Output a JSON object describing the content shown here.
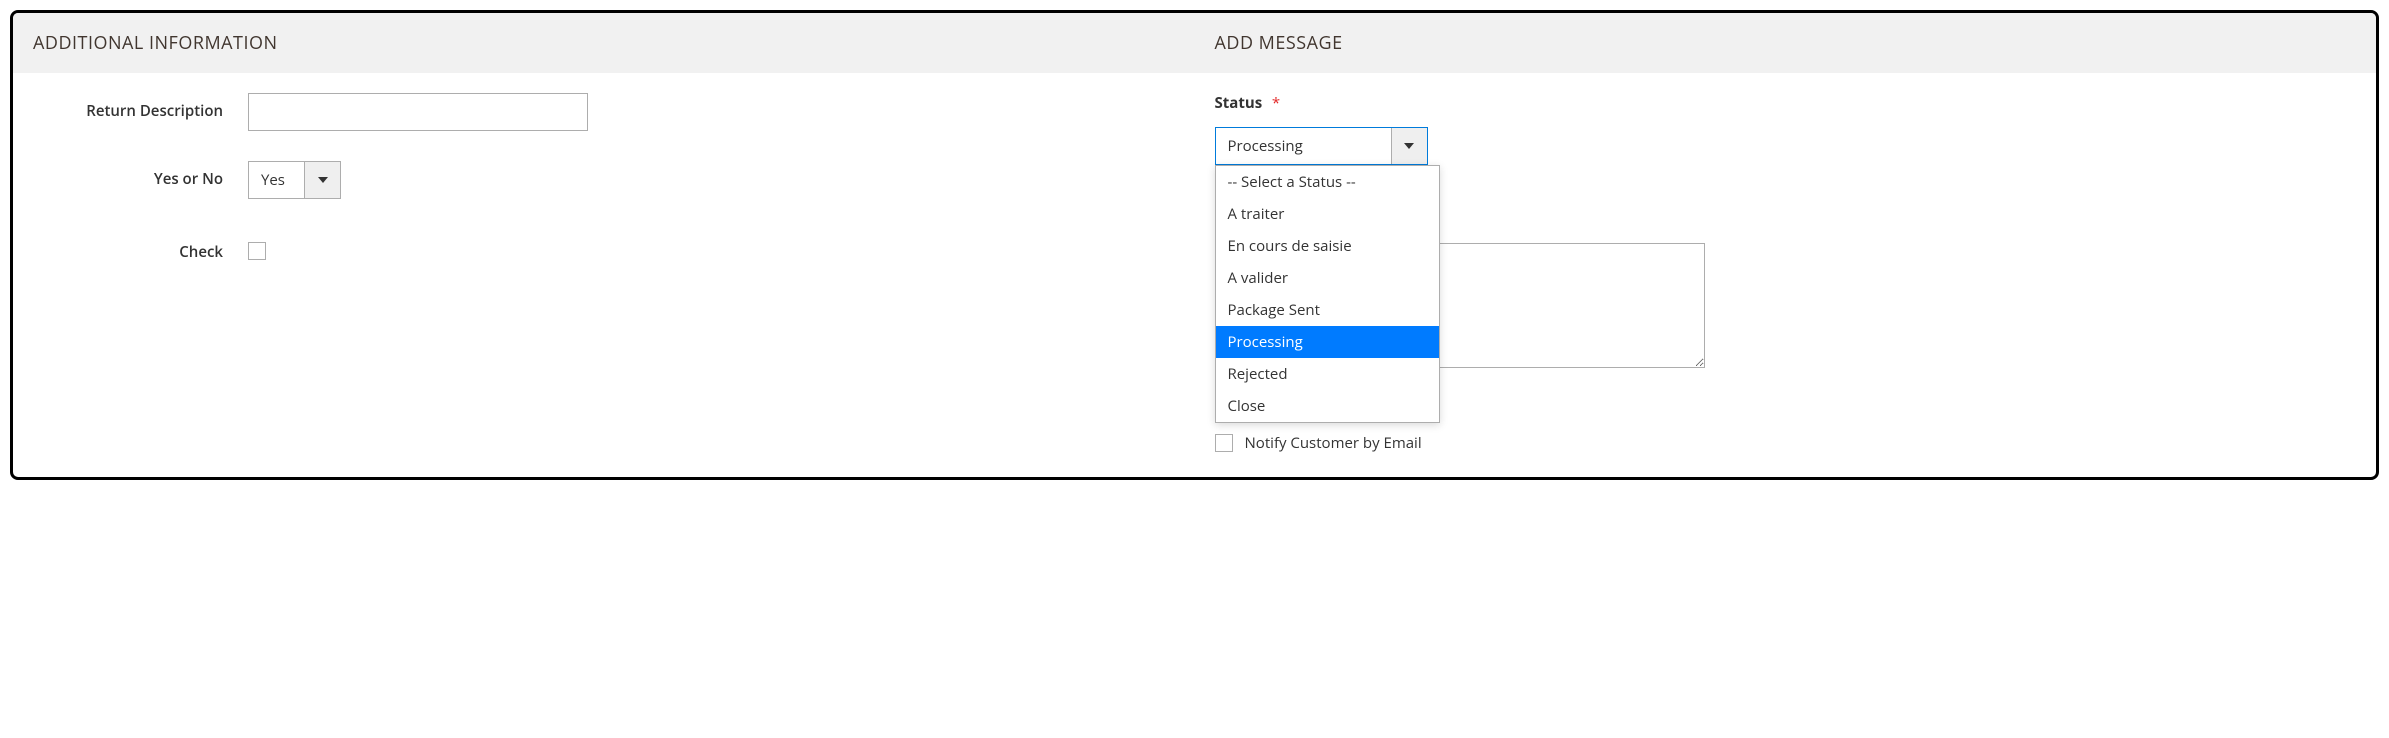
{
  "sections": {
    "additional_info_title": "ADDITIONAL INFORMATION",
    "add_message_title": "ADD MESSAGE"
  },
  "additional_info": {
    "return_description": {
      "label": "Return Description",
      "value": ""
    },
    "yes_or_no": {
      "label": "Yes or No",
      "selected": "Yes"
    },
    "check": {
      "label": "Check",
      "checked": false
    }
  },
  "add_message": {
    "status": {
      "label": "Status",
      "required": true,
      "selected": "Processing",
      "options": [
        "-- Select a Status --",
        "A traiter",
        "En cours de saisie",
        "A valider",
        "Package Sent",
        "Processing",
        "Rejected",
        "Close"
      ]
    },
    "message_text": "",
    "notify": {
      "label": "Notify Customer by Email",
      "checked": false
    }
  }
}
